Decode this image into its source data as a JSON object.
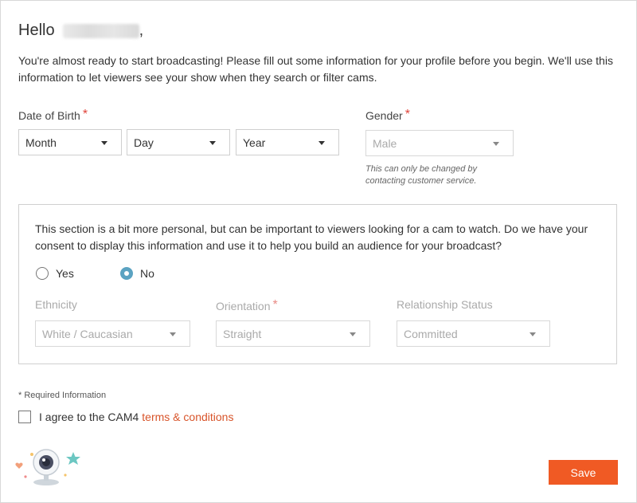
{
  "greeting": {
    "hello": "Hello",
    "comma": ","
  },
  "intro_text": "You're almost ready to start broadcasting! Please fill out some information for your profile before you begin. We'll use this information to let viewers see your show when they search or filter cams.",
  "dob": {
    "label": "Date of Birth",
    "required_mark": "*",
    "month": "Month",
    "day": "Day",
    "year": "Year"
  },
  "gender": {
    "label": "Gender",
    "required_mark": "*",
    "value": "Male",
    "hint_line1": "This can only be changed by",
    "hint_line2": "contacting customer service."
  },
  "consent": {
    "text": "This section is a bit more personal, but can be important to viewers looking for a cam to watch. Do we have your consent to display this information and use it to help you build an audience for your broadcast?",
    "yes_label": "Yes",
    "no_label": "No",
    "selected": "No"
  },
  "ethnicity": {
    "label": "Ethnicity",
    "value": "White / Caucasian"
  },
  "orientation": {
    "label": "Orientation",
    "required_mark": "*",
    "value": "Straight"
  },
  "relationship": {
    "label": "Relationship Status",
    "value": "Committed"
  },
  "required_note": "* Required Information",
  "agree": {
    "prefix": "I agree to the CAM4",
    "link": "terms & conditions"
  },
  "save_label": "Save",
  "colors": {
    "accent": "#f05a24",
    "link": "#d8542a",
    "radio": "#5ba3c2",
    "required": "#e0433a"
  }
}
